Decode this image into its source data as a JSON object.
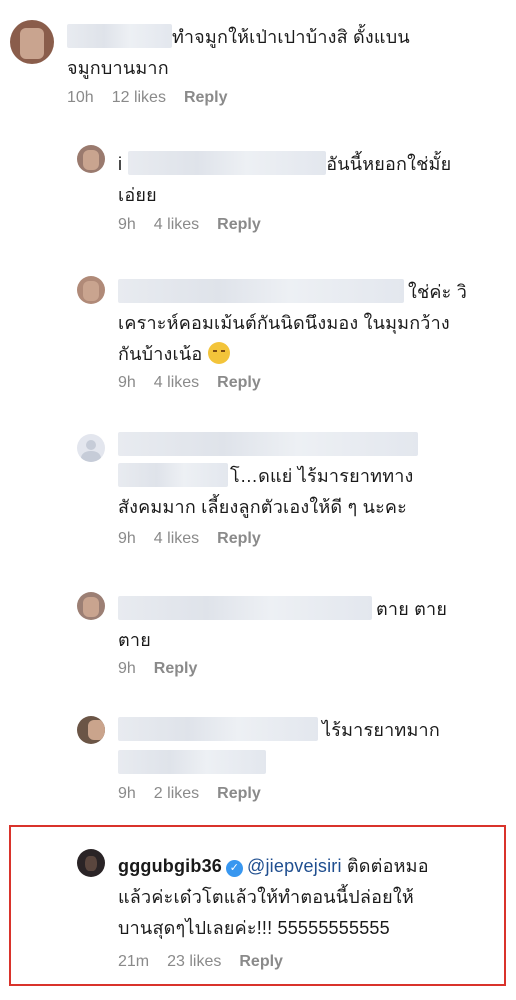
{
  "comments": [
    {
      "line1": "ทำจมูกให้เป่าเปาบ้างสิ ดั้งแบน",
      "line2": "จมูกบานมาก",
      "time": "10h",
      "likes": "12 likes",
      "reply": "Reply"
    },
    {
      "prefix": "i",
      "line1": "อันนี้หยอกใช่มั้ย",
      "line2": "เอ่ยย",
      "time": "9h",
      "likes": "4 likes",
      "reply": "Reply"
    },
    {
      "line1": "ใช่ค่ะ วิ",
      "line2": "เคราะห์คอมเม้นต์กันนิดนึงมอง ในมุมกว้าง",
      "line3": "กันบ้างเน้อ",
      "time": "9h",
      "likes": "4 likes",
      "reply": "Reply"
    },
    {
      "line2": "โ…ดแย่ ไร้มารยาททาง",
      "line3": "สังคมมาก เลี้ยงลูกตัวเองให้ดี ๆ นะคะ",
      "time": "9h",
      "likes": "4 likes",
      "reply": "Reply"
    },
    {
      "line1": "ตาย ตาย",
      "line2": "ตาย",
      "time": "9h",
      "reply": "Reply"
    },
    {
      "line1": "ไร้มารยาทมาก",
      "time": "9h",
      "likes": "2 likes",
      "reply": "Reply"
    },
    {
      "username": "gggubgib36",
      "verified_mark": "✓",
      "mention": "@jiepvejsiri",
      "line1": "ติดต่อหมอ",
      "line2": "แล้วค่ะเด๋วโตแล้วให้ทำตอนนี้ปล่อยให้",
      "line3": "บานสุดๆไปเลยค่ะ!!! 55555555555",
      "time": "21m",
      "likes": "23 likes",
      "reply": "Reply"
    }
  ]
}
